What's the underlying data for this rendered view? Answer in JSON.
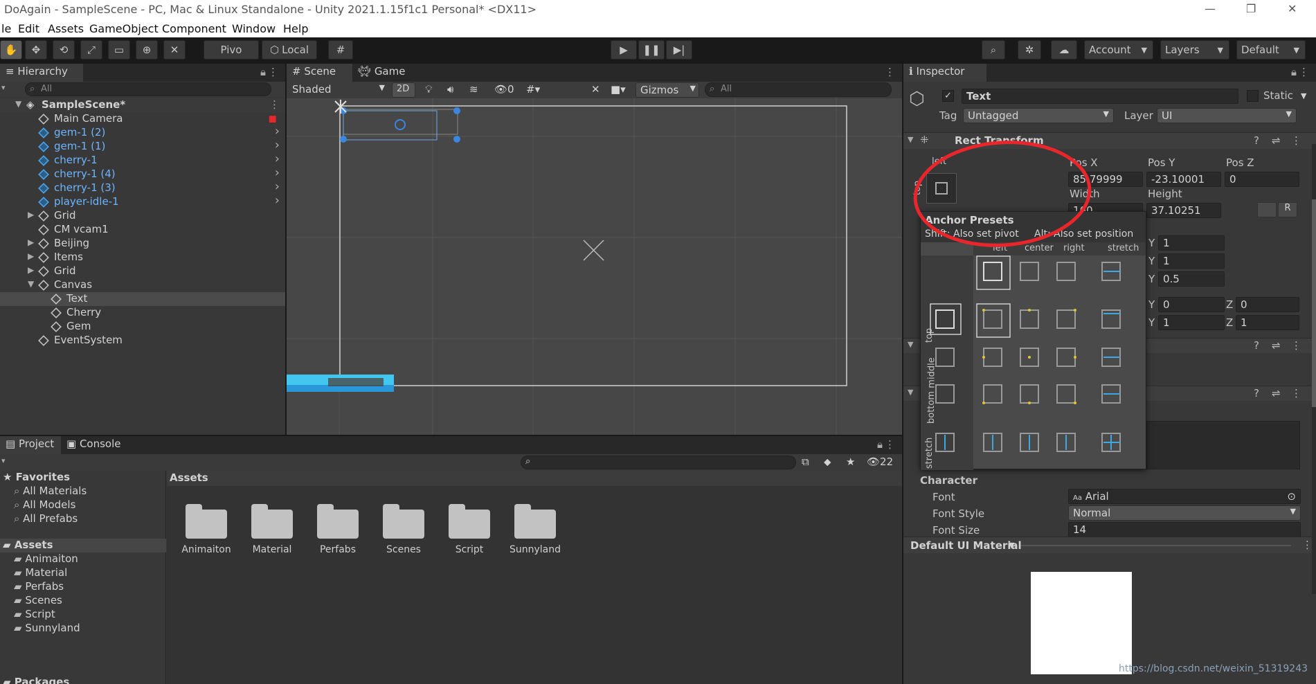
{
  "window": {
    "title": "DoAgain - SampleScene - PC, Mac & Linux Standalone - Unity 2021.1.15f1c1 Personal* <DX11>",
    "min": "—",
    "restore": "❐",
    "close": "✕"
  },
  "menu": [
    "le",
    "Edit",
    "Assets",
    "GameObject",
    "Component",
    "Window",
    "Help"
  ],
  "toolbar": {
    "pivot": "Pivo",
    "local": "Local",
    "account": "Account",
    "layers": "Layers",
    "layout": "Default"
  },
  "hierarchy": {
    "tab": "Hierarchy",
    "search_placeholder": "All",
    "scene": "SampleScene*",
    "items": [
      {
        "label": "Main Camera",
        "indent": 1,
        "prefab": false
      },
      {
        "label": "gem-1 (2)",
        "indent": 1,
        "prefab": true
      },
      {
        "label": "gem-1 (1)",
        "indent": 1,
        "prefab": true
      },
      {
        "label": "cherry-1",
        "indent": 1,
        "prefab": true
      },
      {
        "label": "cherry-1 (4)",
        "indent": 1,
        "prefab": true
      },
      {
        "label": "cherry-1 (3)",
        "indent": 1,
        "prefab": true
      },
      {
        "label": "player-idle-1",
        "indent": 1,
        "prefab": true
      },
      {
        "label": "Grid",
        "indent": 1,
        "prefab": false
      },
      {
        "label": "CM vcam1",
        "indent": 1,
        "prefab": false
      },
      {
        "label": "Beijing",
        "indent": 1,
        "prefab": false
      },
      {
        "label": "Items",
        "indent": 1,
        "prefab": false
      },
      {
        "label": "Grid",
        "indent": 1,
        "prefab": false
      },
      {
        "label": "Canvas",
        "indent": 1,
        "prefab": false
      },
      {
        "label": "Text",
        "indent": 2,
        "prefab": false
      },
      {
        "label": "Cherry",
        "indent": 2,
        "prefab": false
      },
      {
        "label": "Gem",
        "indent": 2,
        "prefab": false
      },
      {
        "label": "EventSystem",
        "indent": 1,
        "prefab": false
      }
    ]
  },
  "scene": {
    "tab_scene": "Scene",
    "tab_game": "Game",
    "shading": "Shaded",
    "mode_2d": "2D",
    "hidden_count": "0",
    "gizmos": "Gizmos",
    "search_placeholder": "All"
  },
  "project": {
    "tab_project": "Project",
    "tab_console": "Console",
    "hidden_count": "22",
    "favorites_label": "Favorites",
    "favorites": [
      "All Materials",
      "All Models",
      "All Prefabs"
    ],
    "assets_label": "Assets",
    "asset_folders": [
      "Animaiton",
      "Material",
      "Perfabs",
      "Scenes",
      "Script",
      "Sunnyland"
    ],
    "packages_label": "Packages",
    "breadcrumb": "Assets",
    "grid": [
      "Animaiton",
      "Material",
      "Perfabs",
      "Scenes",
      "Script",
      "Sunnyland"
    ]
  },
  "inspector": {
    "tab": "Inspector",
    "object_name": "Text",
    "static_label": "Static",
    "tag_label": "Tag",
    "tag_value": "Untagged",
    "layer_label": "Layer",
    "layer_value": "UI",
    "rect_transform": "Rect Transform",
    "anchor_h": "left",
    "anchor_v": "top",
    "posx_label": "Pos X",
    "posx_value": "85.79999",
    "posy_label": "Pos Y",
    "posy_value": "-23.10001",
    "posz_label": "Pos Z",
    "posz_value": "0",
    "width_label": "Width",
    "width_value": "160",
    "height_label": "Height",
    "height_value": "37.10251",
    "r_button": "R",
    "rows": [
      {
        "l1": "Y",
        "v1": "1"
      },
      {
        "l1": "Y",
        "v1": "1"
      },
      {
        "l1": "Y",
        "v1": "0.5"
      }
    ],
    "rot": {
      "y": "0",
      "z": "0"
    },
    "scale": {
      "y": "1",
      "z": "1"
    },
    "character_label": "Character",
    "font_label": "Font",
    "font_value": "Arial",
    "font_style_label": "Font Style",
    "font_style_value": "Normal",
    "font_size_label": "Font Size",
    "font_size_value": "14",
    "material_label": "Default UI Material"
  },
  "anchor_presets": {
    "title": "Anchor Presets",
    "shift_hint": "Shift: Also set pivot",
    "alt_hint": "Alt: Also set position",
    "columns": [
      "left",
      "center",
      "right",
      "stretch"
    ],
    "rows": [
      "top",
      "middle",
      "bottom",
      "stretch"
    ]
  },
  "watermark": "https://blog.csdn.net/weixin_51319243",
  "colors": {
    "accent_blue": "#4fa3e6",
    "highlight_red": "#e8262c",
    "anchor_yellow": "#e6c230",
    "stretch_cyan": "#3ea8e0"
  }
}
